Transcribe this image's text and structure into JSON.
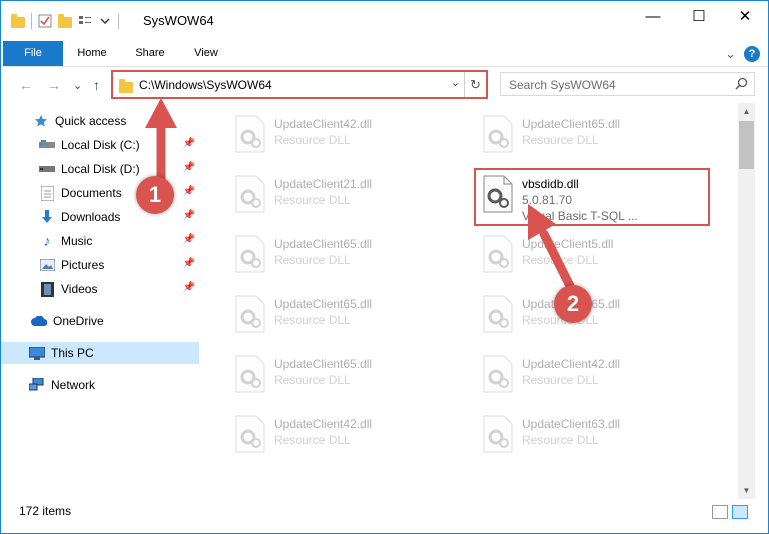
{
  "window": {
    "title": "SysWOW64",
    "controls": {
      "minimize": "—",
      "maximize": "☐",
      "close": "✕"
    }
  },
  "ribbon": {
    "tabs": [
      "File",
      "Home",
      "Share",
      "View"
    ],
    "expand_glyph": "⌄",
    "help_glyph": "?"
  },
  "nav_buttons": {
    "back": "←",
    "forward": "→",
    "recent": "⌄",
    "up": "↑"
  },
  "address": {
    "path": "C:\\Windows\\SysWOW64",
    "dropdown_glyph": "⌄",
    "refresh_glyph": "↻"
  },
  "search": {
    "placeholder": "Search SysWOW64"
  },
  "sidebar": {
    "pin_glyph": "📌",
    "items": [
      {
        "label": "Quick access",
        "icon": "star-icon"
      },
      {
        "label": "Local Disk (C:)",
        "icon": "drive-icon"
      },
      {
        "label": "Local Disk (D:)",
        "icon": "drive-icon"
      },
      {
        "label": "Documents",
        "icon": "documents-icon"
      },
      {
        "label": "Downloads",
        "icon": "download-icon"
      },
      {
        "label": "Music",
        "icon": "music-icon"
      },
      {
        "label": "Pictures",
        "icon": "pictures-icon"
      },
      {
        "label": "Videos",
        "icon": "videos-icon"
      },
      {
        "label": "OneDrive",
        "icon": "cloud-icon"
      },
      {
        "label": "This PC",
        "icon": "monitor-icon"
      },
      {
        "label": "Network",
        "icon": "network-icon"
      }
    ]
  },
  "files": {
    "left": [
      {
        "name": "UpdateClient42.dll",
        "desc": "Resource DLL"
      },
      {
        "name": "UpdateClient21.dll",
        "desc": "Resource DLL"
      },
      {
        "name": "UpdateClient65.dll",
        "desc": "Resource DLL"
      },
      {
        "name": "UpdateClient65.dll",
        "desc": "Resource DLL"
      },
      {
        "name": "UpdateClient65.dll",
        "desc": "Resource DLL"
      },
      {
        "name": "UpdateClient42.dll",
        "desc": "Resource DLL"
      }
    ],
    "right": [
      {
        "name": "UpdateClient65.dll",
        "desc": "Resource DLL"
      },
      {
        "name": "vbsdidb.dll",
        "desc": "5.0.81.70",
        "desc2": "Visual Basic T-SQL ..."
      },
      {
        "name": "UpdateClient5.dll",
        "desc": "Resource DLL"
      },
      {
        "name": "UpdateClient65.dll",
        "desc": "Resource DLL"
      },
      {
        "name": "UpdateClient42.dll",
        "desc": "Resource DLL"
      },
      {
        "name": "UpdateClient63.dll",
        "desc": "Resource DLL"
      }
    ]
  },
  "scrollbar": {
    "up": "▲",
    "down": "▼"
  },
  "status": {
    "item_count": "172 items"
  },
  "annotations": {
    "badge1": "1",
    "badge2": "2"
  },
  "colors": {
    "accent": "#1979ca",
    "annotation_red": "#d9534f",
    "selected_bg": "#cce8ff"
  }
}
